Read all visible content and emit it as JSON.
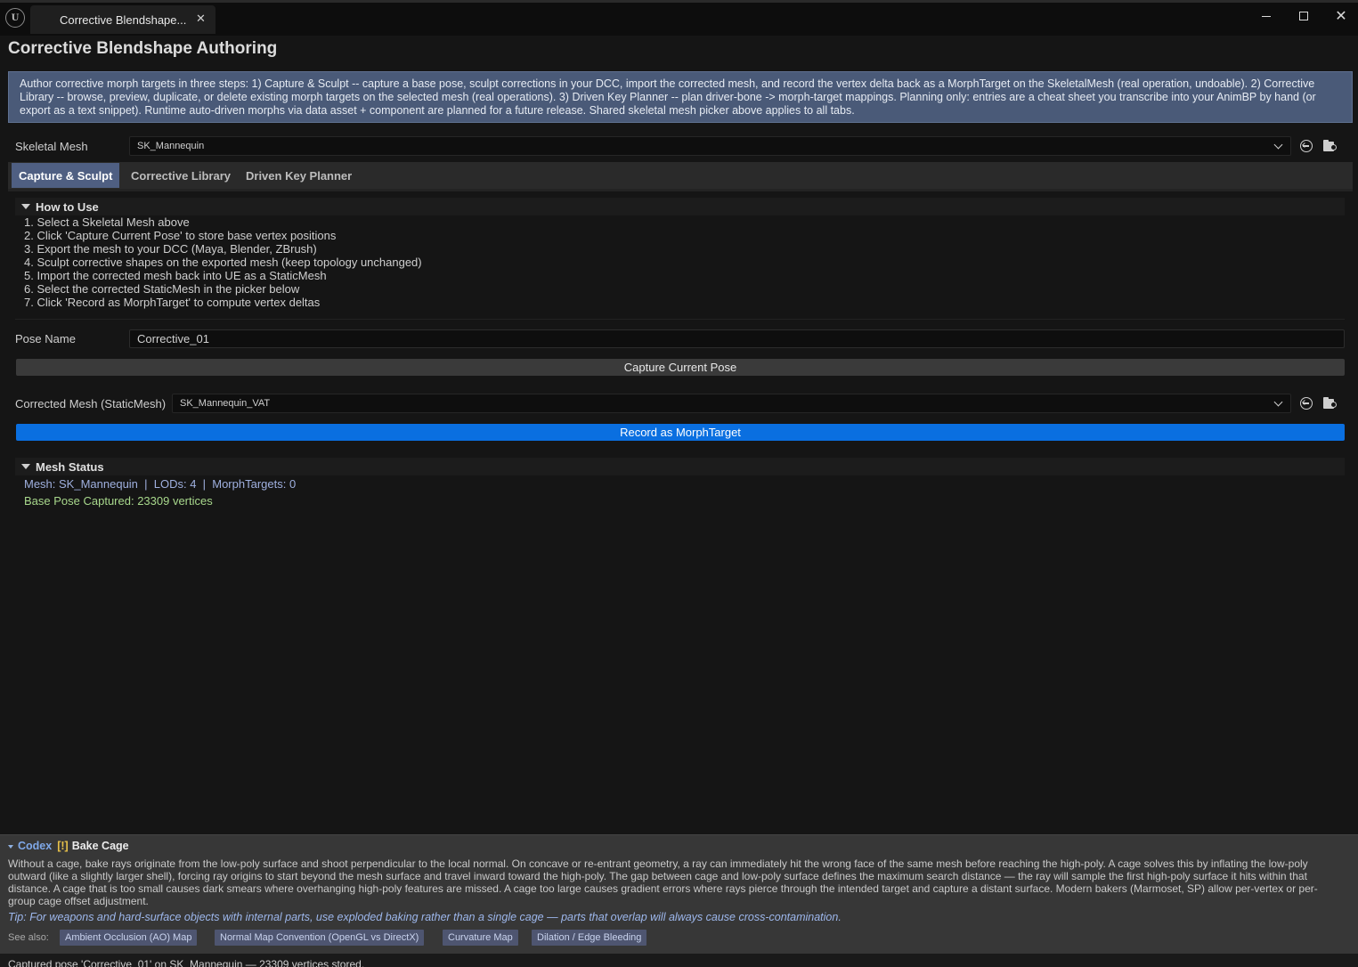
{
  "window": {
    "tab_title": "Corrective Blendshape...",
    "app_title": "Corrective Blendshape Authoring"
  },
  "banner": {
    "text": "Author corrective morph targets in three steps: 1) Capture & Sculpt -- capture a base pose, sculpt corrections in your DCC, import the corrected mesh, and record the vertex delta back as a MorphTarget on the SkeletalMesh (real operation, undoable). 2) Corrective Library -- browse, preview, duplicate, or delete existing morph targets on the selected mesh (real operations). 3) Driven Key Planner -- plan driver-bone -> morph-target mappings. Planning only: entries are a cheat sheet you transcribe into your AnimBP by hand (or export as a text snippet). Runtime auto-driven morphs via data asset + component are planned for a future release. Shared skeletal mesh picker above applies to all tabs."
  },
  "skeletal_mesh": {
    "label": "Skeletal Mesh",
    "value": "SK_Mannequin"
  },
  "tabs": [
    {
      "label": "Capture & Sculpt",
      "active": true
    },
    {
      "label": "Corrective Library",
      "active": false
    },
    {
      "label": "Driven Key Planner",
      "active": false
    }
  ],
  "how_to_use": {
    "title": "How to Use",
    "steps": [
      "1. Select a Skeletal Mesh above",
      "2. Click 'Capture Current Pose' to store base vertex positions",
      "3. Export the mesh to your DCC (Maya, Blender, ZBrush)",
      "4. Sculpt corrective shapes on the exported mesh (keep topology unchanged)",
      "5. Import the corrected mesh back into UE as a StaticMesh",
      "6. Select the corrected StaticMesh in the picker below",
      "7. Click 'Record as MorphTarget' to compute vertex deltas"
    ]
  },
  "pose_name": {
    "label": "Pose Name",
    "value": "Corrective_01"
  },
  "capture_button": "Capture Current Pose",
  "corrected_mesh": {
    "label": "Corrected Mesh (StaticMesh)",
    "value": "SK_Mannequin_VAT"
  },
  "record_button": "Record as MorphTarget",
  "mesh_status": {
    "title": "Mesh Status",
    "info": "Mesh: SK_Mannequin  |  LODs: 4  |  MorphTargets: 0",
    "pose": "Base Pose Captured: 23309 vertices"
  },
  "codex": {
    "keyword": "Codex",
    "badge": "[!]",
    "title": "Bake Cage",
    "body": "Without a cage, bake rays originate from the low-poly surface and shoot perpendicular to the local normal. On concave or re-entrant geometry, a ray can immediately hit the wrong face of the same mesh before reaching the high-poly. A cage solves this by inflating the low-poly outward (like a slightly larger shell), forcing ray origins to start beyond the mesh surface and travel inward toward the high-poly. The gap between cage and low-poly surface defines the maximum search distance — the ray will sample the first high-poly surface it hits within that distance. A cage that is too small causes dark smears where overhanging high-poly features are missed. A cage too large causes gradient errors where rays pierce through the intended target and capture a distant surface. Modern bakers (Marmoset, SP) allow per-vertex or per-group cage offset adjustment.",
    "tip": "Tip: For weapons and hard-surface objects with internal parts, use exploded baking rather than a single cage — parts that overlap will always cause cross-contamination.",
    "see_also_label": "See also:",
    "see_also": [
      "Ambient Occlusion (AO) Map",
      "Normal Map Convention (OpenGL vs DirectX)",
      "Curvature Map",
      "Dilation / Edge Bleeding"
    ]
  },
  "status_bar": "Captured pose 'Corrective_01' on SK_Mannequin — 23309 vertices stored."
}
